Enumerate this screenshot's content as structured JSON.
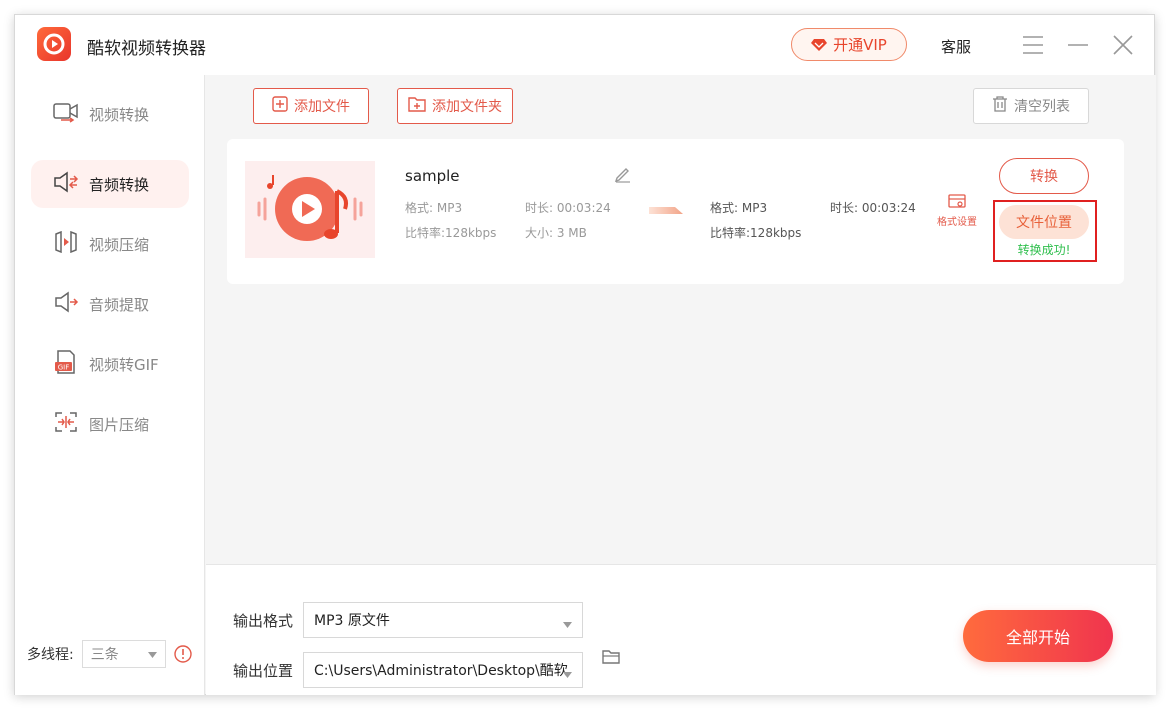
{
  "app": {
    "title": "酷软视频转换器",
    "vip_label": "开通VIP",
    "service_label": "客服"
  },
  "sidebar": {
    "items": [
      {
        "label": "视频转换",
        "icon": "video-convert-icon",
        "active": false
      },
      {
        "label": "音频转换",
        "icon": "audio-convert-icon",
        "active": true
      },
      {
        "label": "视频压缩",
        "icon": "video-compress-icon",
        "active": false
      },
      {
        "label": "音频提取",
        "icon": "audio-extract-icon",
        "active": false
      },
      {
        "label": "视频转GIF",
        "icon": "gif-icon",
        "active": false
      },
      {
        "label": "图片压缩",
        "icon": "image-compress-icon",
        "active": false
      }
    ],
    "threads_label": "多线程:",
    "threads_value": "三条"
  },
  "toolbar": {
    "add_file": "添加文件",
    "add_folder": "添加文件夹",
    "clear_list": "清空列表"
  },
  "file": {
    "name": "sample",
    "source": {
      "format": "格式: MP3",
      "duration": "时长: 00:03:24",
      "bitrate": "比特率:128kbps",
      "size": "大小: 3 MB"
    },
    "target": {
      "format": "格式: MP3",
      "duration": "时长: 00:03:24",
      "bitrate": "比特率:128kbps"
    },
    "format_setting": "格式设置",
    "convert_label": "转换",
    "location_label": "文件位置",
    "status": "转换成功!"
  },
  "output": {
    "format_label": "输出格式",
    "format_value": "MP3  原文件",
    "location_label": "输出位置",
    "location_value": "C:\\Users\\Administrator\\Desktop\\酷软",
    "start_label": "全部开始"
  },
  "colors": {
    "accent": "#e35a4a",
    "success": "#2fbf4d",
    "active_bg": "#fff1ef"
  }
}
